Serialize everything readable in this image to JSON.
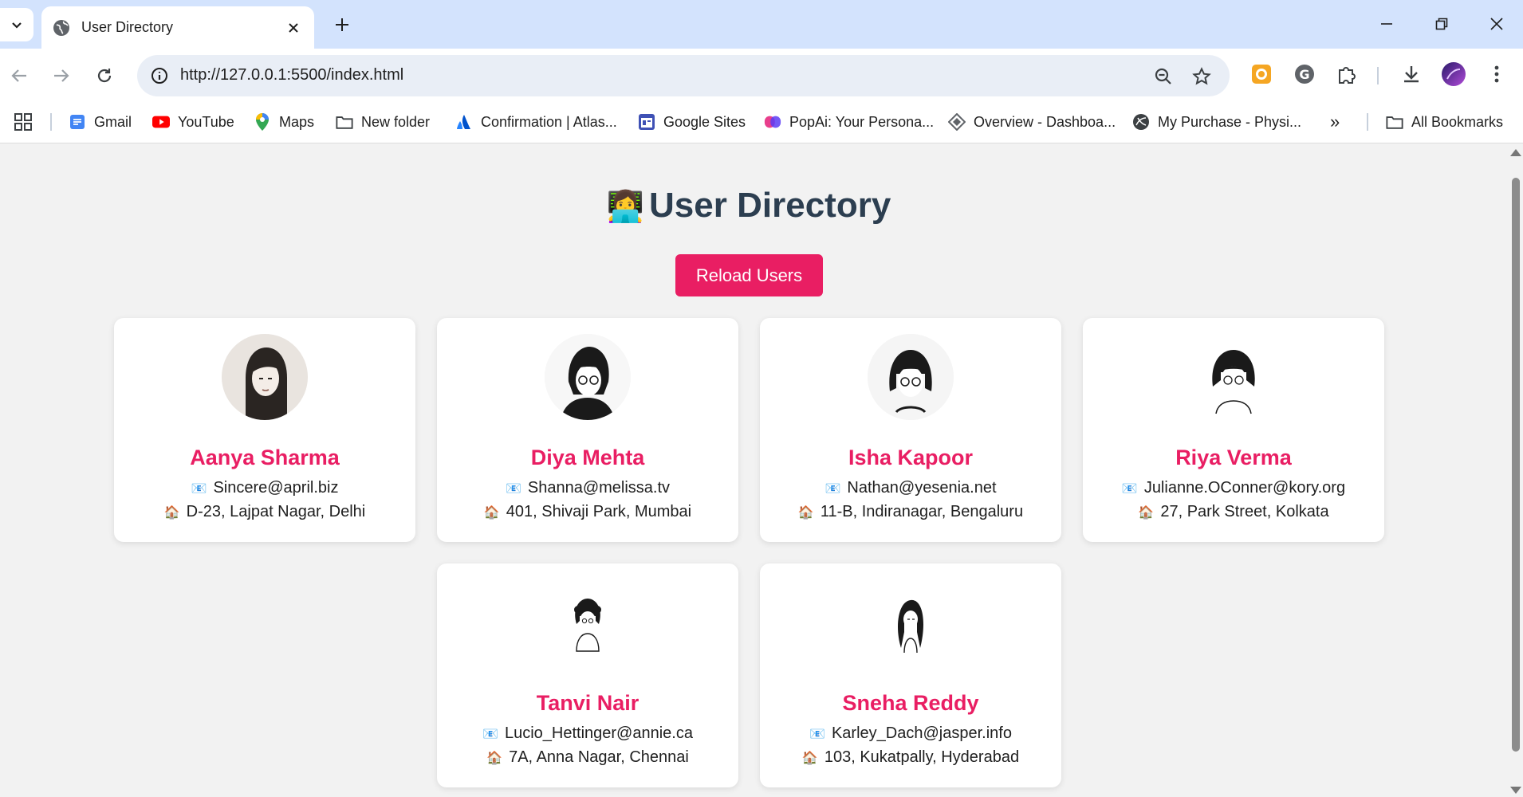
{
  "browser": {
    "tab_title": "User Directory",
    "url": "http://127.0.0.1:5500/index.html",
    "bookmarks": [
      {
        "label": "Gmail",
        "icon": "gmail-icon"
      },
      {
        "label": "YouTube",
        "icon": "youtube-icon"
      },
      {
        "label": "Maps",
        "icon": "maps-icon"
      },
      {
        "label": "New folder",
        "icon": "folder-icon"
      },
      {
        "label": "Confirmation | Atlas...",
        "icon": "atlassian-icon"
      },
      {
        "label": "Google Sites",
        "icon": "google-sites-icon"
      },
      {
        "label": "PopAi: Your Persona...",
        "icon": "popai-icon"
      },
      {
        "label": "Overview - Dashboa...",
        "icon": "dashboard-icon"
      },
      {
        "label": "My Purchase - Physi...",
        "icon": "physics-icon"
      }
    ],
    "all_bookmarks_label": "All Bookmarks",
    "overflow_label": "»"
  },
  "page": {
    "title_emoji": "👩‍💻",
    "title": "User Directory",
    "reload_label": "Reload Users",
    "email_icon": "📧",
    "address_icon": "🏠",
    "accent_color": "#e91e63",
    "title_color": "#2c3e50"
  },
  "users": [
    {
      "name": "Aanya Sharma",
      "email": "Sincere@april.biz",
      "address": "D-23, Lajpat Nagar, Delhi"
    },
    {
      "name": "Diya Mehta",
      "email": "Shanna@melissa.tv",
      "address": "401, Shivaji Park, Mumbai"
    },
    {
      "name": "Isha Kapoor",
      "email": "Nathan@yesenia.net",
      "address": "11-B, Indiranagar, Bengaluru"
    },
    {
      "name": "Riya Verma",
      "email": "Julianne.OConner@kory.org",
      "address": "27, Park Street, Kolkata"
    },
    {
      "name": "Tanvi Nair",
      "email": "Lucio_Hettinger@annie.ca",
      "address": "7A, Anna Nagar, Chennai"
    },
    {
      "name": "Sneha Reddy",
      "email": "Karley_Dach@jasper.info",
      "address": "103, Kukatpally, Hyderabad"
    }
  ]
}
